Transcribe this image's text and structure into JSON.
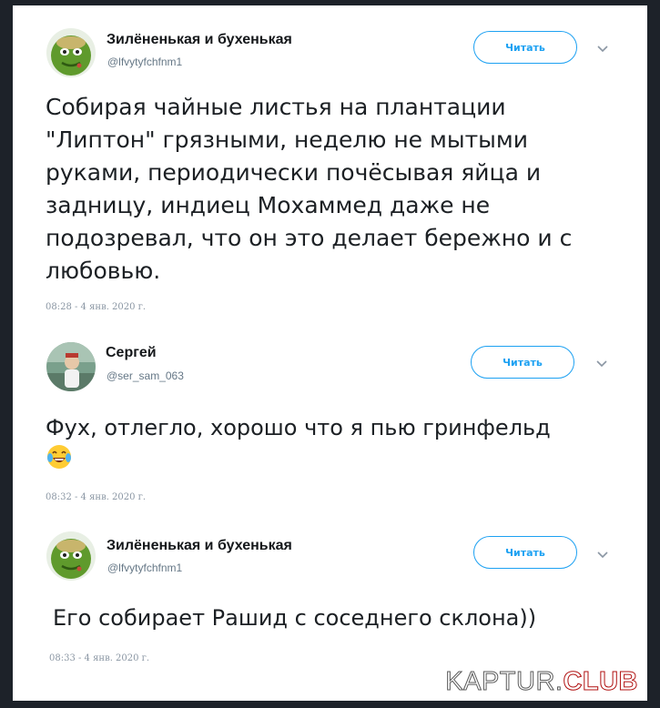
{
  "tweets": [
    {
      "author": "Зилёненькая и бухенькая",
      "handle": "@lfvytyfchfnm1",
      "follow_label": "Читать",
      "lines": [
        "Собирая чайные листья на плантации",
        "\"Липтон\" грязными, неделю не мытыми",
        "руками, периодически почёсывая яйца и",
        "задницу, индиец Мохаммед даже не",
        "подозревал, что он это делает бережно и с",
        "любовью."
      ],
      "timestamp": "08:28 - 4 янв. 2020 г.",
      "avatar_icon": "green-frog-avatar"
    },
    {
      "author": "Сергей",
      "handle": "@ser_sam_063",
      "follow_label": "Читать",
      "lines": [
        "Фух, отлегло, хорошо что я пью гринфельд"
      ],
      "emoji": "face-with-tears-of-joy",
      "timestamp": "08:32 - 4 янв. 2020 г.",
      "avatar_icon": "photo-avatar"
    },
    {
      "author": "Зилёненькая и бухенькая",
      "handle": "@lfvytyfchfnm1",
      "follow_label": "Читать",
      "lines": [
        "Его собирает Рашид с соседнего склона))"
      ],
      "timestamp": "08:33 - 4 янв. 2020 г.",
      "avatar_icon": "green-frog-avatar"
    }
  ],
  "watermark": {
    "part1": "KAPTUR.",
    "part2": "CLUB"
  },
  "colors": {
    "accent": "#1da1f2",
    "text": "#1c2024",
    "muted": "#657786",
    "frame": "#1d2229"
  }
}
